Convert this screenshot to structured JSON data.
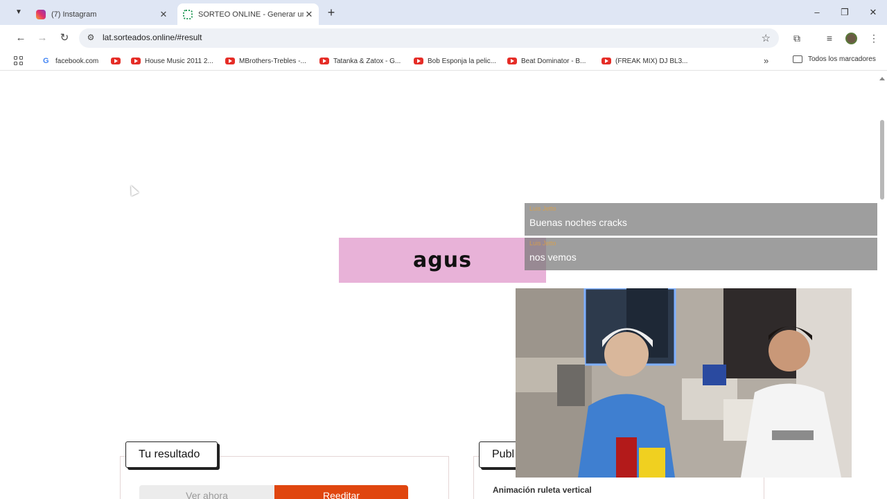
{
  "browser": {
    "tabs": [
      {
        "title": "(7) Instagram",
        "active": false,
        "favicon": "instagram-icon"
      },
      {
        "title": "SORTEO ONLINE - Generar un s",
        "active": true,
        "favicon": "sorteados-icon"
      }
    ],
    "url": "lat.sorteados.online/#result",
    "bookmarks": [
      {
        "label": "facebook.com",
        "icon": "google-icon"
      },
      {
        "label": "",
        "icon": "youtube-icon"
      },
      {
        "label": "House Music 2011 2...",
        "icon": "youtube-icon"
      },
      {
        "label": "MBrothers-Trebles -...",
        "icon": "youtube-icon"
      },
      {
        "label": "Tatanka & Zatox - G...",
        "icon": "youtube-icon"
      },
      {
        "label": "Bob Esponja la pelic...",
        "icon": "youtube-icon"
      },
      {
        "label": "Beat Dominator - B...",
        "icon": "youtube-icon"
      },
      {
        "label": "(FREAK MIX) DJ BL3...",
        "icon": "youtube-icon"
      }
    ],
    "all_bookmarks_label": "Todos los marcadores"
  },
  "page": {
    "winner": "agus",
    "result_tab_label": "Tu resultado",
    "publish_tab_label": "Publ",
    "view_now_label": "Ver ahora",
    "reedit_label": "Reeditar",
    "animation_label": "Animación ruleta vertical"
  },
  "overlay": {
    "chat": [
      {
        "user": "Luis Jetto",
        "text": "Buenas noches cracks"
      },
      {
        "user": "Luis Jetto",
        "text": "nos vemos"
      }
    ]
  },
  "colors": {
    "winner_bg": "#e8b2d8",
    "reedit_btn": "#e0460f",
    "tabstrip": "#dfe6f4"
  }
}
